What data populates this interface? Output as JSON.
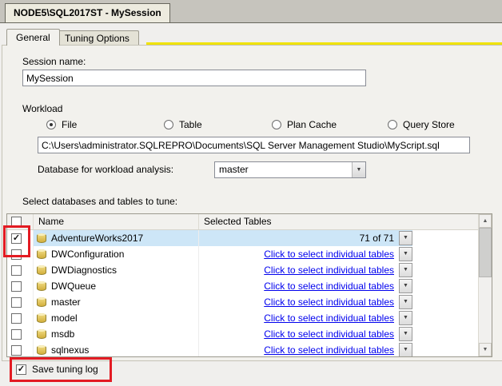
{
  "window": {
    "title": "NODE5\\SQL2017ST - MySession"
  },
  "tabs": [
    {
      "label": "General",
      "active": true
    },
    {
      "label": "Tuning Options",
      "active": false
    }
  ],
  "session": {
    "label": "Session name:",
    "value": "MySession"
  },
  "workload": {
    "label": "Workload",
    "options": [
      {
        "label": "File",
        "selected": true
      },
      {
        "label": "Table",
        "selected": false
      },
      {
        "label": "Plan Cache",
        "selected": false
      },
      {
        "label": "Query Store",
        "selected": false
      }
    ],
    "file_path": "C:\\Users\\administrator.SQLREPRO\\Documents\\SQL Server Management Studio\\MyScript.sql",
    "database_label": "Database for workload analysis:",
    "database_value": "master"
  },
  "tune": {
    "label": "Select databases and tables to tune:",
    "columns": [
      "Name",
      "Selected Tables"
    ],
    "rows": [
      {
        "name": "AdventureWorks2017",
        "checked": true,
        "selected": true,
        "selected_tables": "71 of 71",
        "link": false
      },
      {
        "name": "DWConfiguration",
        "checked": false,
        "selected": false,
        "selected_tables": "Click to select individual tables",
        "link": true
      },
      {
        "name": "DWDiagnostics",
        "checked": false,
        "selected": false,
        "selected_tables": "Click to select individual tables",
        "link": true
      },
      {
        "name": "DWQueue",
        "checked": false,
        "selected": false,
        "selected_tables": "Click to select individual tables",
        "link": true
      },
      {
        "name": "master",
        "checked": false,
        "selected": false,
        "selected_tables": "Click to select individual tables",
        "link": true
      },
      {
        "name": "model",
        "checked": false,
        "selected": false,
        "selected_tables": "Click to select individual tables",
        "link": true
      },
      {
        "name": "msdb",
        "checked": false,
        "selected": false,
        "selected_tables": "Click to select individual tables",
        "link": true
      },
      {
        "name": "sqlnexus",
        "checked": false,
        "selected": false,
        "selected_tables": "Click to select individual tables",
        "link": true
      }
    ]
  },
  "footer": {
    "save_label": "Save tuning log",
    "checked": true
  },
  "icons": {
    "check": "✓",
    "dropdown": "▼",
    "scroll_up": "▲",
    "scroll_down": "▼"
  },
  "colors": {
    "accent": "#F0E300",
    "link": "#0000EE",
    "selection": "#CDE6F7",
    "annotation": "#E31B23"
  }
}
